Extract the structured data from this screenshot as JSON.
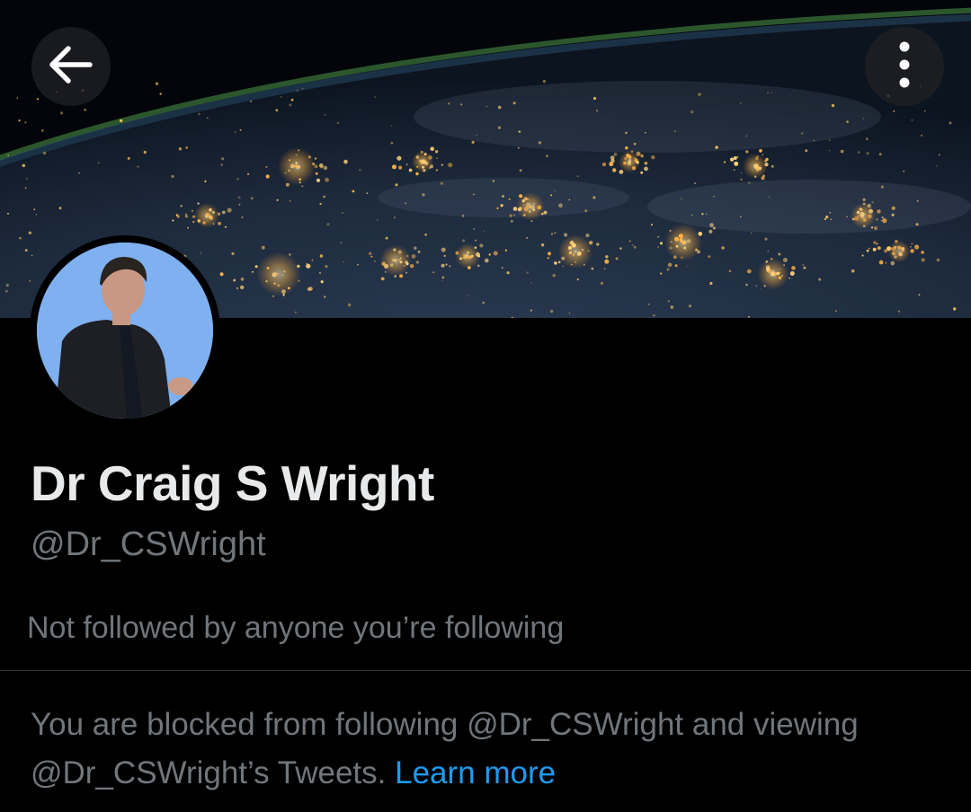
{
  "header": {
    "back_icon": "arrow-left-icon",
    "more_icon": "more-vertical-icon"
  },
  "banner": {
    "description_icon": "earth-at-night-banner"
  },
  "profile": {
    "display_name": "Dr Craig S Wright",
    "handle": "@Dr_CSWright",
    "followed_by_text": "Not followed by anyone you’re following"
  },
  "blocked_notice": {
    "line1_text": "You are blocked from following @Dr_CSWright and viewing",
    "line2_text": "@Dr_CSWright’s Tweets.",
    "learn_more_label": "Learn more"
  },
  "colors": {
    "background": "#000000",
    "primary_text": "#e7e9ea",
    "secondary_text": "#71767b",
    "link": "#1d9bf0",
    "divider": "#2f3336"
  }
}
